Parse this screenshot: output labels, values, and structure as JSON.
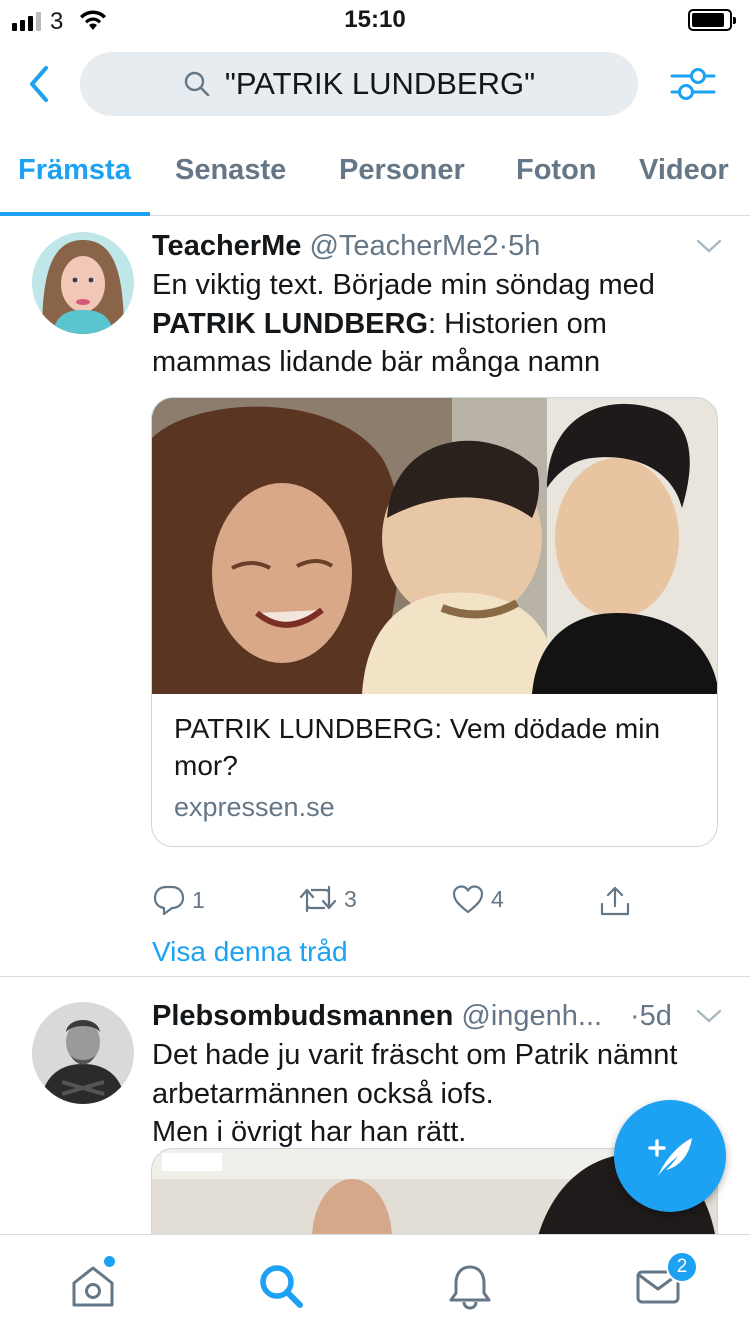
{
  "status_bar": {
    "carrier": "3",
    "time": "15:10"
  },
  "header": {
    "search_query": "\"PATRIK LUNDBERG\""
  },
  "tabs": [
    {
      "label": "Främsta",
      "active": true
    },
    {
      "label": "Senaste",
      "active": false
    },
    {
      "label": "Personer",
      "active": false
    },
    {
      "label": "Foton",
      "active": false
    },
    {
      "label": "Videor",
      "active": false
    }
  ],
  "tweets": [
    {
      "name": "TeacherMe",
      "handle": "@TeacherMe2",
      "sep": "·",
      "time": "5h",
      "text_before": "En viktig text. Började min söndag med",
      "text_bold": "PATRIK LUNDBERG",
      "text_after": ": Historien om mammas lidande bär många namn",
      "card": {
        "title": "PATRIK LUNDBERG: Vem dödade min mor?",
        "domain": "expressen.se"
      },
      "replies": "1",
      "retweets": "3",
      "likes": "4",
      "thread_link": "Visa denna tråd"
    },
    {
      "name": "Plebsombudsmannen",
      "handle": "@ingenh...",
      "sep": "·",
      "time": "5d",
      "text": "Det hade ju varit fräscht om Patrik nämnt arbetarmännen också iofs.\nMen i övrigt har han rätt."
    }
  ],
  "bottom_nav": {
    "messages_badge": "2"
  },
  "colors": {
    "accent": "#1da1f2",
    "secondary_text": "#657786",
    "search_bg": "#e6ecf0"
  }
}
